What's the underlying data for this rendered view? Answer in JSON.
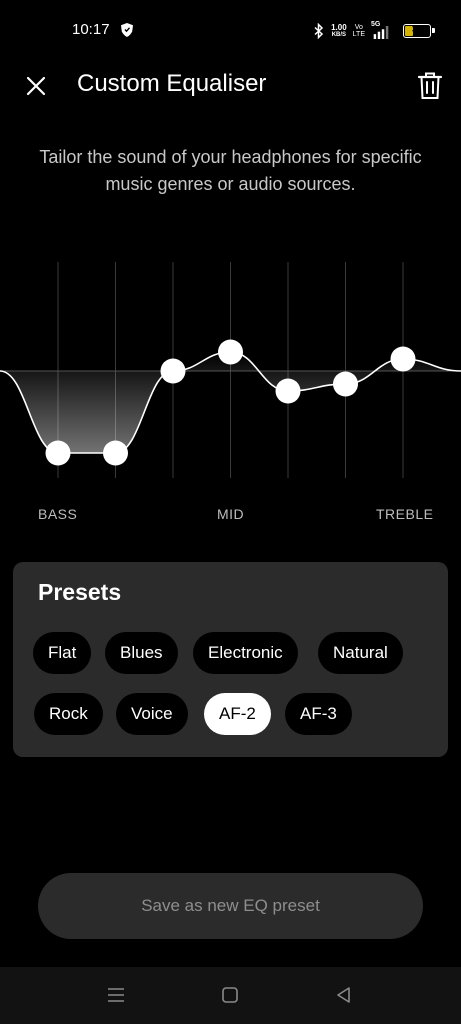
{
  "status_bar": {
    "time": "10:17",
    "network_speed": "1.00",
    "network_speed_unit": "KB/S",
    "volte_top": "Vo",
    "volte_bottom": "LTE",
    "signal_type": "5G",
    "battery_level": "36",
    "icons": [
      "shield-icon",
      "bluetooth-icon",
      "signal-icon",
      "battery-icon"
    ]
  },
  "header": {
    "title": "Custom Equaliser",
    "close_icon": "close-icon",
    "delete_icon": "trash-icon"
  },
  "description": "Tailor the sound of your headphones for specific music genres or audio sources.",
  "equalizer": {
    "band_labels": {
      "low": "BASS",
      "mid": "MID",
      "high": "TREBLE"
    },
    "band_count": 7,
    "gain_levels_normalized": [
      -0.82,
      -0.82,
      0.0,
      0.19,
      -0.2,
      -0.13,
      0.12
    ],
    "colors": {
      "curve": "#ffffff",
      "handle": "#ffffff",
      "grid": "#3a3a3a"
    }
  },
  "presets": {
    "title": "Presets",
    "items": [
      {
        "label": "Flat",
        "selected": false
      },
      {
        "label": "Blues",
        "selected": false
      },
      {
        "label": "Electronic",
        "selected": false
      },
      {
        "label": "Natural",
        "selected": false
      },
      {
        "label": "Rock",
        "selected": false
      },
      {
        "label": "Voice",
        "selected": false
      },
      {
        "label": "AF-2",
        "selected": true
      },
      {
        "label": "AF-3",
        "selected": false
      }
    ]
  },
  "actions": {
    "save_label": "Save as new EQ preset"
  },
  "navigation_bar": {
    "icons": [
      "menu-icon",
      "home-icon",
      "back-icon"
    ]
  },
  "colors": {
    "background": "#000000",
    "panel": "#2b2b2b",
    "chip_selected": "#ffffff",
    "save_text": "#8e8e8e"
  }
}
